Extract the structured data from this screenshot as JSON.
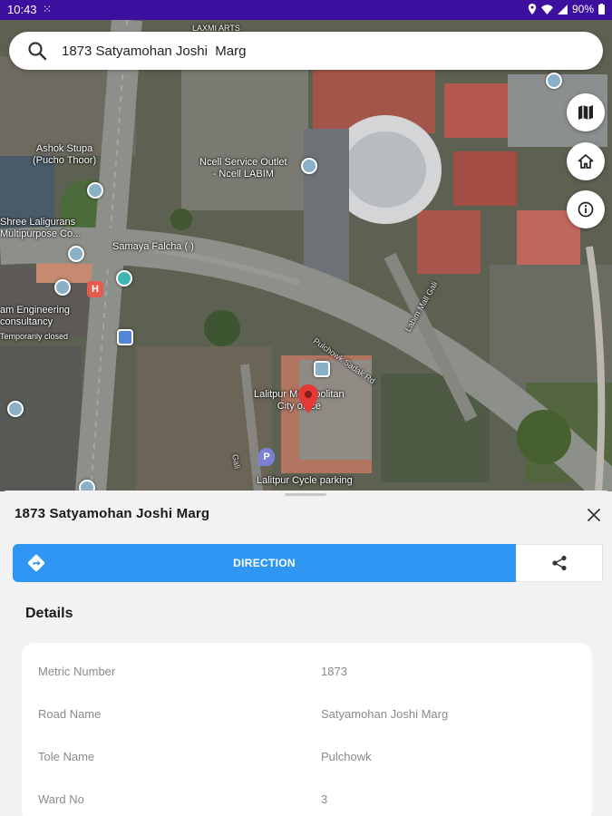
{
  "status_bar": {
    "time": "10:43",
    "battery": "90%"
  },
  "search": {
    "value": "1873 Satyamohan Joshi  Marg"
  },
  "map": {
    "labels": {
      "laxmi_arts": "LAXMI ARTS",
      "ashok_stupa": "Ashok Stupa\n(Pucho Thoor)",
      "ncell": "Ncell Service Outlet\n- Ncell LABIM",
      "shree_laligurans": "Shree Laligurans\nMultipurpose Co...",
      "samaya_falcha": "Samaya Falcha ( )",
      "engineering": "am Engineering\nconsultancy",
      "temp_closed": "Temporarily closed",
      "pulchowk_sadak": "Pulchowk Sadak Rd",
      "labim_gali": "Labim Mall Gali",
      "lalitpur_metro": "Lalitpur Metropolitan\nCity office",
      "cycle_parking": "Lalitpur Cycle parking",
      "gali": "Gali"
    }
  },
  "sheet": {
    "title": "1873 Satyamohan Joshi  Marg",
    "direction_label": "DIRECTION",
    "details_heading": "Details",
    "details": [
      {
        "key": "Metric Number",
        "value": "1873"
      },
      {
        "key": "Road Name",
        "value": "Satyamohan Joshi  Marg"
      },
      {
        "key": "Tole Name",
        "value": "Pulchowk"
      },
      {
        "key": "Ward No",
        "value": "3"
      }
    ]
  },
  "colors": {
    "status_bar": "#3d0f9e",
    "direction_button": "#2f96f3",
    "pin": "#e53935"
  },
  "icons": [
    "search-icon",
    "map-icon",
    "home-icon",
    "info-icon",
    "close-icon",
    "directions-icon",
    "share-icon",
    "location-pin-icon"
  ]
}
